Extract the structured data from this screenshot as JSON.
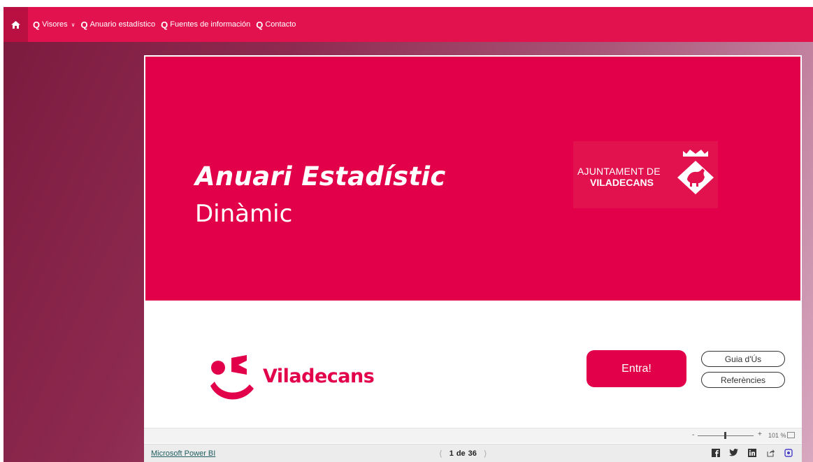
{
  "nav": {
    "items": [
      {
        "label": "Visores"
      },
      {
        "label": "Anuario estadístico"
      },
      {
        "label": "Fuentes de información"
      },
      {
        "label": "Contacto"
      }
    ]
  },
  "hero": {
    "title": "Anuari Estadístic",
    "subtitle": "Dinàmic",
    "ajuntament_line1": "AJUNTAMENT DE",
    "ajuntament_line2": "VILADECANS"
  },
  "footer_logo": {
    "text": "Viladecans"
  },
  "buttons": {
    "entra": "Entra!",
    "guia": "Guia d'Ús",
    "referencies": "Referències"
  },
  "zoom": {
    "minus": "-",
    "plus": "+",
    "value": "101 %"
  },
  "status": {
    "powerbi_link": "Microsoft Power BI",
    "page_current": "1",
    "page_sep": "de",
    "page_total": "36"
  },
  "colors": {
    "brand": "#e2004b",
    "nav": "#e2124f"
  }
}
